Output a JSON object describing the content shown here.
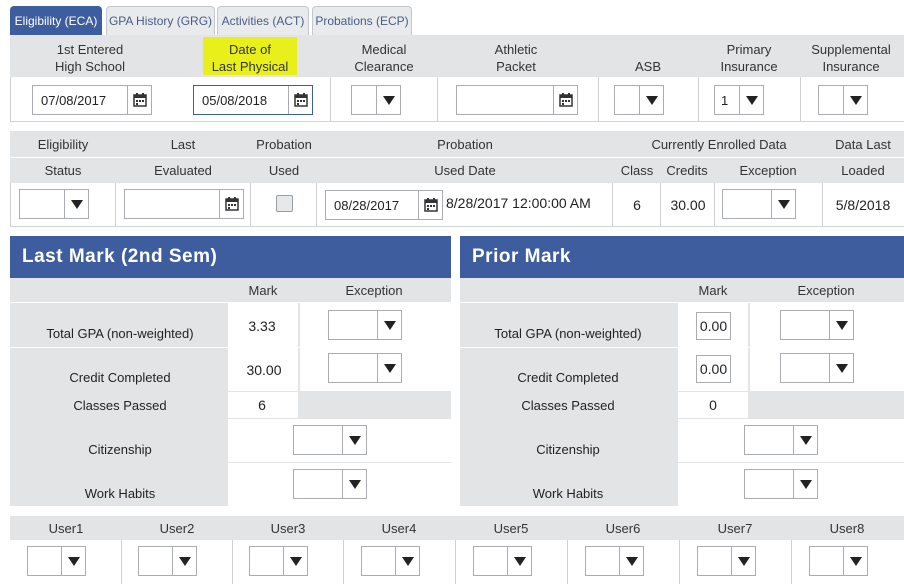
{
  "tabs": [
    {
      "label": "Eligibility (ECA)"
    },
    {
      "label": "GPA History (GRG)"
    },
    {
      "label": "Activities (ACT)"
    },
    {
      "label": "Probations (ECP)"
    }
  ],
  "top_section": {
    "columns": [
      {
        "label": "1st Entered\nHigh School",
        "value": "07/08/2017"
      },
      {
        "label": "Date of\nLast Physical",
        "value": "05/08/2018",
        "highlight": "#e9ef1a"
      },
      {
        "label": "Medical\nClearance",
        "value": ""
      },
      {
        "label": "Athletic\nPacket",
        "value": ""
      },
      {
        "label": "ASB",
        "value": ""
      },
      {
        "label": "Primary\nInsurance",
        "value": "1"
      },
      {
        "label": "Supplemental\nInsurance",
        "value": ""
      }
    ]
  },
  "status_section": {
    "header_row1": {
      "eligibility": "Eligibility",
      "last": "Last",
      "probation": "Probation",
      "probation_used_date": "Probation",
      "enrolled": "Currently Enrolled Data",
      "data_last": "Data Last"
    },
    "header_row2": {
      "status": "Status",
      "evaluated": "Evaluated",
      "used": "Used",
      "used_date": "Used Date",
      "class": "Class",
      "credits": "Credits",
      "exception": "Exception",
      "loaded": "Loaded"
    },
    "values": {
      "status": "",
      "last_evaluated": "",
      "probation_used": false,
      "probation_used_date": "08/28/2017",
      "used_date_text": "8/28/2017 12:00:00 AM",
      "class": "6",
      "credits": "30.00",
      "exception": "",
      "loaded": "5/8/2018"
    }
  },
  "last_mark": {
    "title": "Last Mark (2nd Sem)",
    "col_mark": "Mark",
    "col_exception": "Exception",
    "rows": {
      "total_gpa": {
        "label": "Total GPA (non-weighted)",
        "mark": "3.33"
      },
      "credit_completed": {
        "label": "Credit Completed",
        "mark": "30.00"
      },
      "classes_passed": {
        "label": "Classes Passed",
        "mark": "6"
      },
      "citizenship": {
        "label": "Citizenship"
      },
      "work_habits": {
        "label": "Work Habits"
      }
    }
  },
  "prior_mark": {
    "title": "Prior Mark",
    "col_mark": "Mark",
    "col_exception": "Exception",
    "rows": {
      "total_gpa": {
        "label": "Total GPA (non-weighted)",
        "mark": "0.00"
      },
      "credit_completed": {
        "label": "Credit Completed",
        "mark": "0.00"
      },
      "classes_passed": {
        "label": "Classes Passed",
        "mark": "0"
      },
      "citizenship": {
        "label": "Citizenship"
      },
      "work_habits": {
        "label": "Work Habits"
      }
    }
  },
  "users": {
    "labels": [
      "User1",
      "User2",
      "User3",
      "User4",
      "User5",
      "User6",
      "User7",
      "User8"
    ]
  },
  "colors": {
    "accent": "#3d5d9e",
    "highlight": "#e9ef1a",
    "header_bg": "#e3e4e5"
  }
}
